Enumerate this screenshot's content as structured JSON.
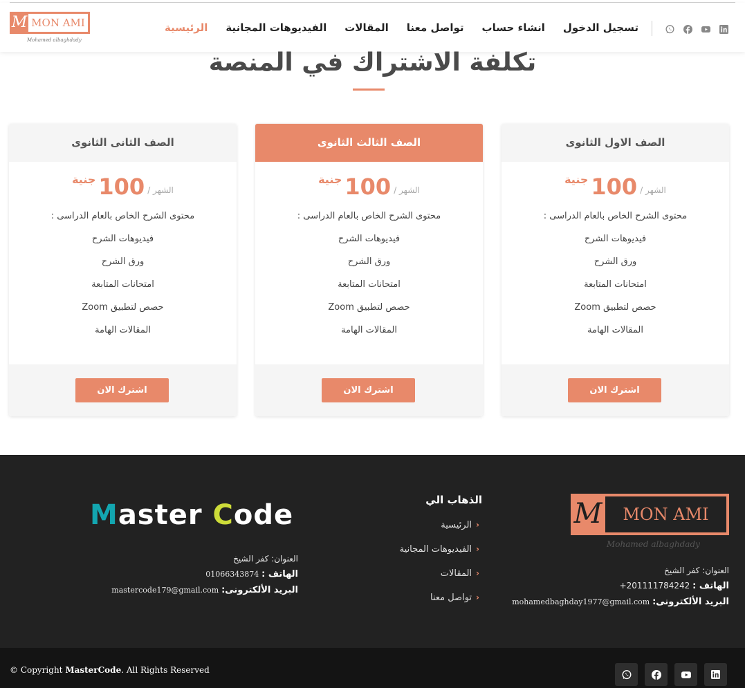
{
  "header": {
    "logo": {
      "mark": "M",
      "text": "MON AMI",
      "sub": "Mohamed albaghdady"
    },
    "nav": [
      {
        "label": "الرئيسية",
        "active": true
      },
      {
        "label": "الفيديوهات المجانية",
        "active": false
      },
      {
        "label": "المقالات",
        "active": false
      },
      {
        "label": "تواصل معنا",
        "active": false
      },
      {
        "label": "انشاء حساب",
        "active": false
      },
      {
        "label": "تسجيل الدخول",
        "active": false
      }
    ],
    "social_icons": [
      "linkedin-icon",
      "youtube-icon",
      "facebook-icon",
      "whatsapp-icon"
    ]
  },
  "section": {
    "title": "تكلفة الاشتراك في المنصة"
  },
  "plans": [
    {
      "name": "الصف الاول الثانوى",
      "featured": false,
      "price": "100",
      "currency": "جنية",
      "period": "الشهر /",
      "features": [
        "محتوى الشرح الخاص بالعام الدراسى :",
        "فيديوهات الشرح",
        "ورق الشرح",
        "امتحانات المتابعة",
        "حصص لتطبيق Zoom",
        "المقالات الهامة"
      ],
      "cta": "اشترك الان"
    },
    {
      "name": "الصف الثالث الثانوى",
      "featured": true,
      "price": "100",
      "currency": "جنية",
      "period": "الشهر /",
      "features": [
        "محتوى الشرح الخاص بالعام الدراسى :",
        "فيديوهات الشرح",
        "ورق الشرح",
        "امتحانات المتابعة",
        "حصص لتطبيق Zoom",
        "المقالات الهامة"
      ],
      "cta": "اشترك الان"
    },
    {
      "name": "الصف الثانى الثانوى",
      "featured": false,
      "price": "100",
      "currency": "جنية",
      "period": "الشهر /",
      "features": [
        "محتوى الشرح الخاص بالعام الدراسى :",
        "فيديوهات الشرح",
        "ورق الشرح",
        "امتحانات المتابعة",
        "حصص لتطبيق Zoom",
        "المقالات الهامة"
      ],
      "cta": "اشترك الان"
    }
  ],
  "footer": {
    "logo": {
      "mark": "M",
      "text": "MON AMI",
      "sub": "Mohamed albaghdady"
    },
    "contact1": {
      "address": "العنوان: كفر الشيخ",
      "phone_label": "الهاتف :",
      "phone": "+201111784242",
      "email_label": "البريد الألكترونى:",
      "email": "mohamedbaghday1977@gmail.com"
    },
    "links_title": "الذهاب الي",
    "links": [
      "الرئيسية",
      "الفيديوهات المجانية",
      "المقالات",
      "تواصل معنا"
    ],
    "master_logo": {
      "part1": "M",
      "part2": "aster ",
      "part3": "C",
      "part4": "ode"
    },
    "contact2": {
      "address": "العنوان: كفر الشيخ",
      "phone_label": "الهاتف :",
      "phone": "01066343874",
      "email_label": "البريد الألكترونى:",
      "email": "mastercode179@gmail.com"
    },
    "copyright": {
      "prefix": "© Copyright ",
      "brand": "MasterCode",
      "suffix": ". All Rights Reserved"
    },
    "social_icons": [
      "linkedin-icon",
      "youtube-icon",
      "facebook-icon",
      "whatsapp-icon"
    ]
  },
  "colors": {
    "accent": "#e8896a",
    "footer_bg": "#222222",
    "bottom_bg": "#141414"
  }
}
